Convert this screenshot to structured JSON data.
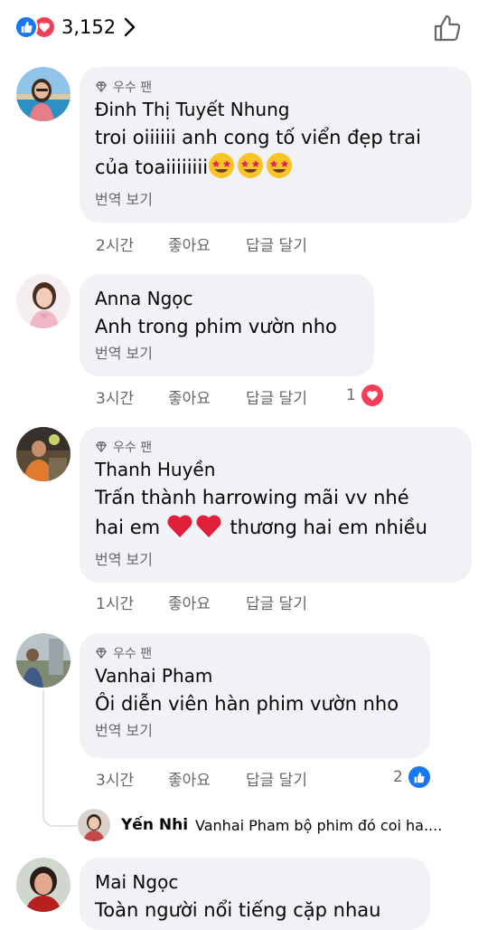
{
  "header": {
    "reaction_count": "3,152",
    "reactions": [
      "like-icon",
      "love-icon"
    ]
  },
  "labels": {
    "fan_badge": "우수 팬",
    "see_translation": "번역 보기",
    "like": "좋아요",
    "reply": "답글 달기"
  },
  "comments": [
    {
      "name": "Đinh Thị Tuyết Nhung",
      "badge": true,
      "text_line1": "troi oiiiiii anh cong tố viển đẹp trai",
      "text_line2": "của toaiiiiiiii",
      "time": "2시간"
    },
    {
      "name": "Anna Ngọc",
      "badge": false,
      "text_line1": "Anh trong phim vườn nho",
      "time": "3시간",
      "reaction_count": "1"
    },
    {
      "name": "Thanh Huyền",
      "badge": true,
      "text_line1": "Trấn thành harrowing mãi vv nhé",
      "text_line2a": "hai em",
      "text_line2b": "thương hai em nhiều",
      "time": "1시간"
    },
    {
      "name": "Vanhai Pham",
      "badge": true,
      "text_line1": "Ôi diễn viên hàn phim vườn nho",
      "time": "3시간",
      "reaction_count": "2"
    },
    {
      "name": "Mai Ngọc",
      "badge": false,
      "text_line1": "Toàn người nổi tiếng cặp nhau"
    }
  ],
  "reply_preview": {
    "name": "Yến Nhi",
    "text": "Vanhai Pham bộ phim đó coi ha...."
  },
  "colors": {
    "bubble": "#f0f2f5",
    "like_blue": "#1877f2",
    "love_red": "#f33e58",
    "meta_gray": "#65676b"
  }
}
